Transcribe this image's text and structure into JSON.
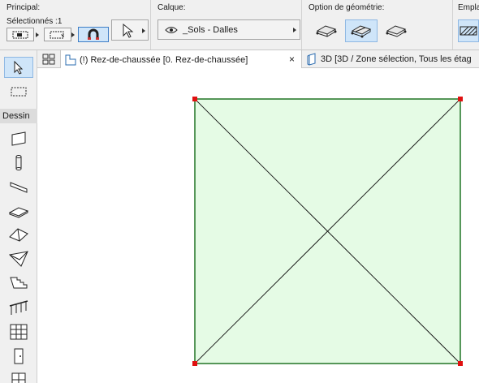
{
  "infobox": {
    "principal": {
      "title": "Principal:",
      "selection_count": "Sélectionnés :1"
    },
    "calque": {
      "title": "Calque:",
      "layer_name": "_Sols - Dalles"
    },
    "geometry": {
      "title": "Option de géométrie:"
    },
    "placement": {
      "title": "Emplac"
    }
  },
  "toolbox": {
    "section_label": "Dessin"
  },
  "tabs": [
    {
      "label": "(!) Rez-de-chaussée [0. Rez-de-chaussée]",
      "close": "×"
    },
    {
      "label": "3D [3D / Zone sélection, Tous les étag"
    }
  ],
  "colors": {
    "slab_fill": "#e5fbe5",
    "slab_outline": "#2e7d32",
    "hotspot": "#e01010",
    "accent": "#cfe5f9"
  }
}
